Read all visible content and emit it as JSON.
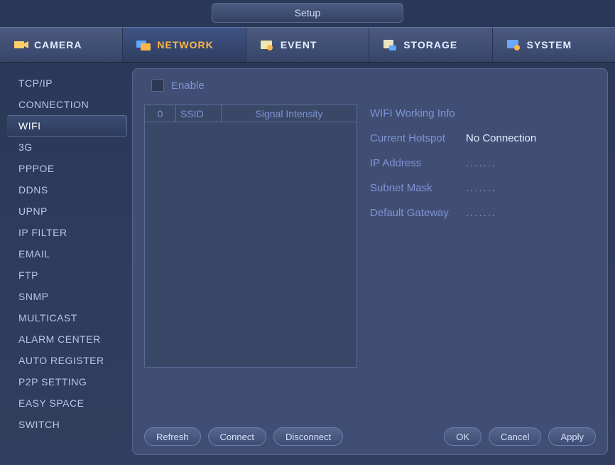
{
  "window_title": "Setup",
  "tabs": {
    "camera": "CAMERA",
    "network": "NETWORK",
    "event": "EVENT",
    "storage": "STORAGE",
    "system": "SYSTEM"
  },
  "sidebar": {
    "items": [
      "TCP/IP",
      "CONNECTION",
      "WIFI",
      "3G",
      "PPPOE",
      "DDNS",
      "UPNP",
      "IP FILTER",
      "EMAIL",
      "FTP",
      "SNMP",
      "MULTICAST",
      "ALARM CENTER",
      "AUTO REGISTER",
      "P2P SETTING",
      "EASY SPACE",
      "SWITCH"
    ],
    "active_index": 2
  },
  "content": {
    "enable_label": "Enable",
    "table": {
      "col_count": "0",
      "col_ssid": "SSID",
      "col_signal": "Signal Intensity"
    },
    "info": {
      "title": "WIFI Working Info",
      "rows": {
        "hotspot_label": "Current Hotspot",
        "hotspot_value": "No Connection",
        "ip_label": "IP Address",
        "ip_value": ".......",
        "mask_label": "Subnet Mask",
        "mask_value": ".......",
        "gw_label": "Default Gateway",
        "gw_value": "......."
      }
    }
  },
  "buttons": {
    "refresh": "Refresh",
    "connect": "Connect",
    "disconnect": "Disconnect",
    "ok": "OK",
    "cancel": "Cancel",
    "apply": "Apply"
  }
}
